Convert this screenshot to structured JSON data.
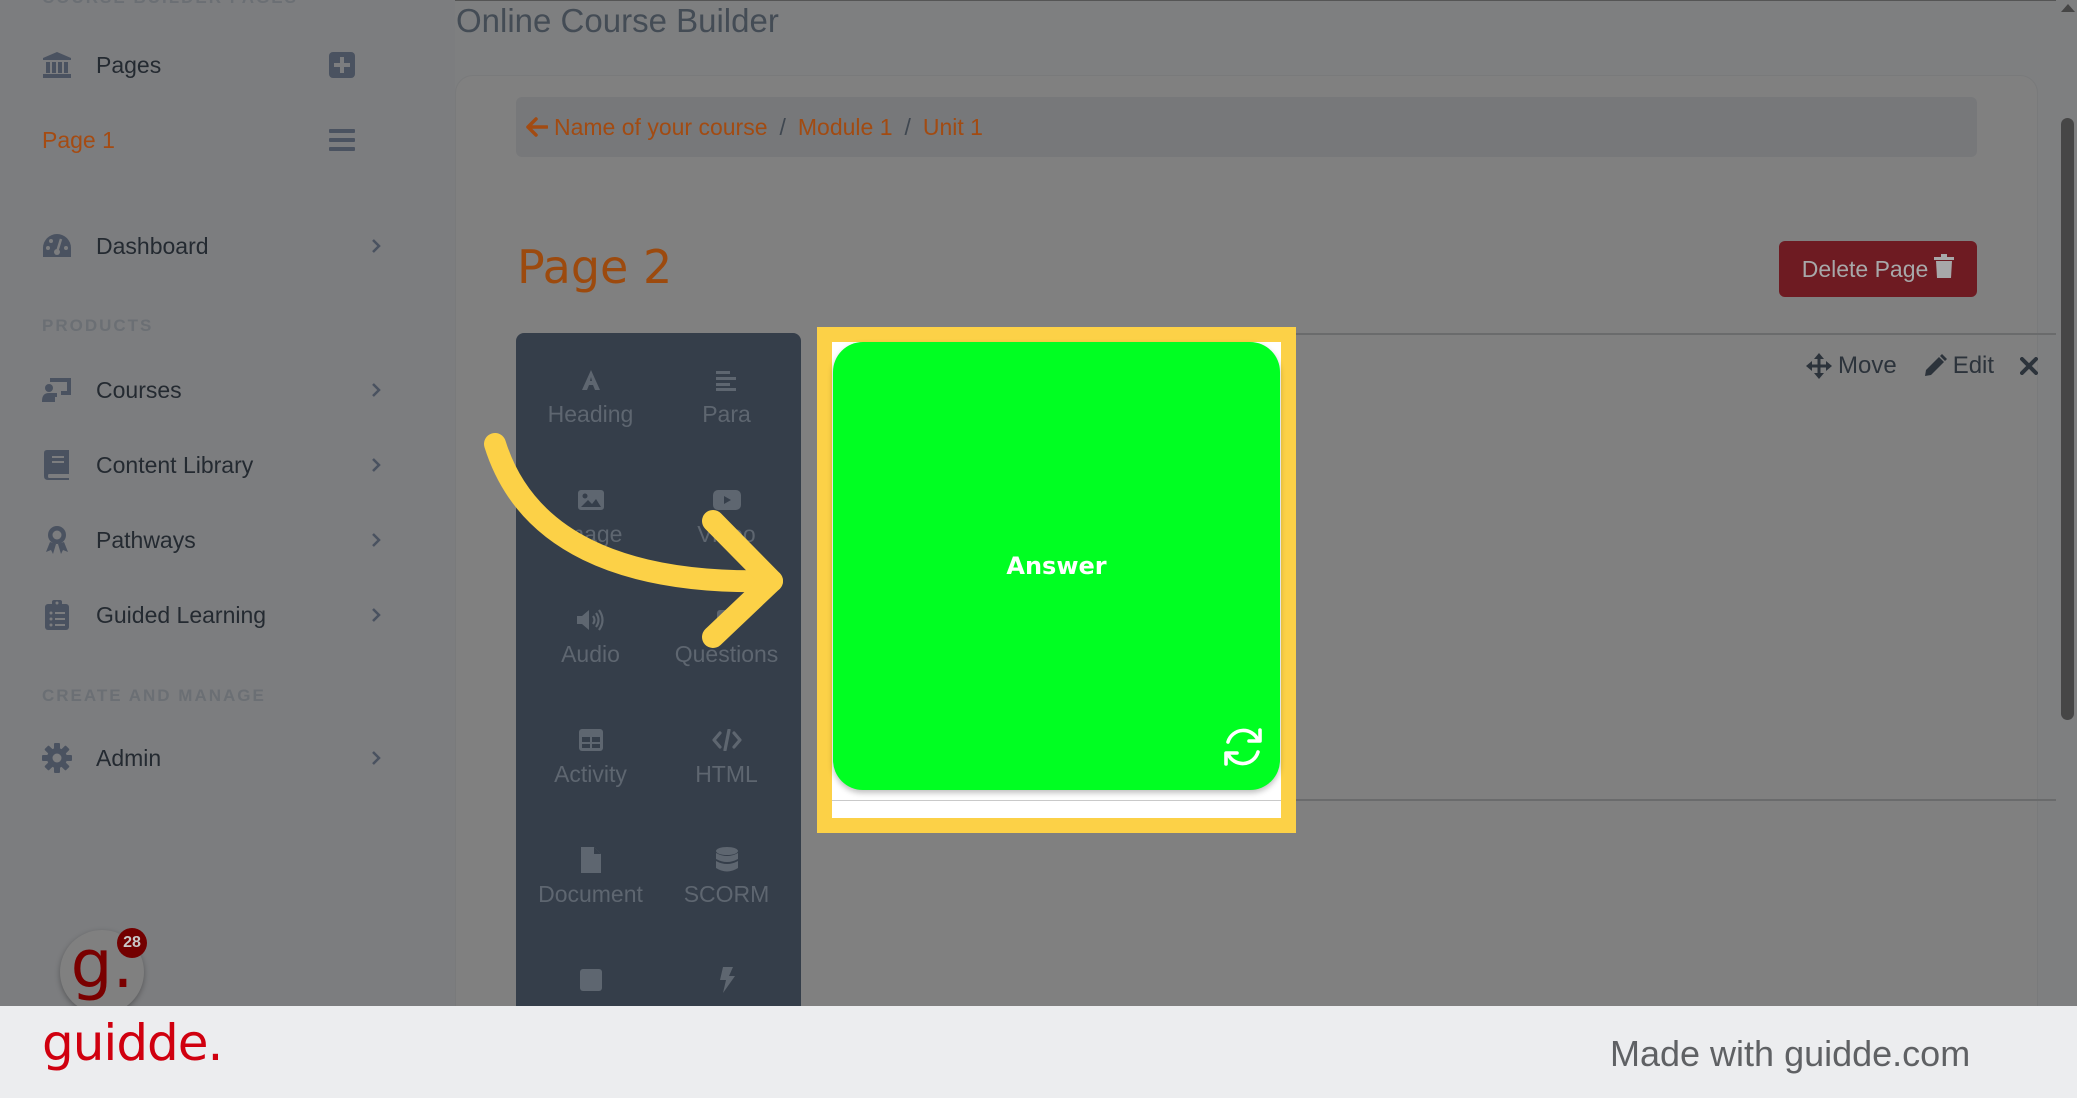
{
  "app": {
    "title": "Online Course Builder"
  },
  "sidebar": {
    "section_pages": "COURSE BUILDER PAGES",
    "pages_label": "Pages",
    "current_page": "Page 1",
    "dashboard": "Dashboard",
    "section_products": "PRODUCTS",
    "products": [
      {
        "label": "Courses",
        "icon": "chalkboard-teacher-icon"
      },
      {
        "label": "Content Library",
        "icon": "book-icon"
      },
      {
        "label": "Pathways",
        "icon": "award-icon"
      },
      {
        "label": "Guided Learning",
        "icon": "clipboard-list-icon"
      }
    ],
    "section_manage": "CREATE AND MANAGE",
    "admin": "Admin"
  },
  "breadcrumb": {
    "items": [
      "Name of your course",
      "Module 1",
      "Unit 1"
    ],
    "separator": "/"
  },
  "page": {
    "title": "Page 2",
    "delete_label": "Delete Page"
  },
  "row_actions": {
    "move": "Move",
    "edit": "Edit"
  },
  "toolbox": {
    "tools": [
      {
        "label": "Heading",
        "icon": "heading-icon"
      },
      {
        "label": "Para",
        "icon": "paragraph-icon"
      },
      {
        "label": "Image",
        "icon": "image-icon"
      },
      {
        "label": "Video",
        "icon": "video-icon"
      },
      {
        "label": "Audio",
        "icon": "audio-icon"
      },
      {
        "label": "Questions",
        "icon": "questions-icon"
      },
      {
        "label": "Activity",
        "icon": "activity-icon"
      },
      {
        "label": "HTML",
        "icon": "code-icon"
      },
      {
        "label": "Document",
        "icon": "document-icon"
      },
      {
        "label": "SCORM",
        "icon": "database-icon"
      },
      {
        "label": "",
        "icon": "square-icon"
      },
      {
        "label": "",
        "icon": "bolt-icon"
      }
    ]
  },
  "flip_card": {
    "text": "Answer",
    "color": "#00ff22"
  },
  "guidde": {
    "badge_count": "28",
    "badge_letter": "g.",
    "logo": "guidde.",
    "made_with": "Made with guidde.com",
    "highlight_color": "#fcd147"
  }
}
